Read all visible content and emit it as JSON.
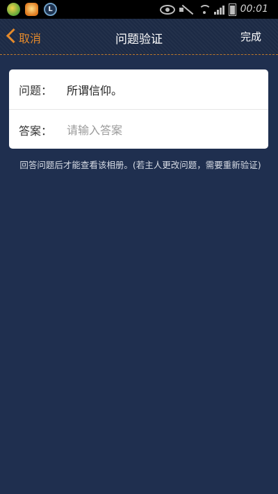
{
  "status_bar": {
    "time": "00:01"
  },
  "nav": {
    "cancel_label": "取消",
    "title": "问题验证",
    "done_label": "完成"
  },
  "question": {
    "label": "问题：",
    "value": "所谓信仰。"
  },
  "answer": {
    "label": "答案：",
    "value": "",
    "placeholder": "请输入答案"
  },
  "hint": "回答问题后才能查看该相册。(若主人更改问题，需要重新验证)",
  "colors": {
    "background": "#1f2f4f",
    "accent": "#e58a2b",
    "card": "#ffffff"
  }
}
